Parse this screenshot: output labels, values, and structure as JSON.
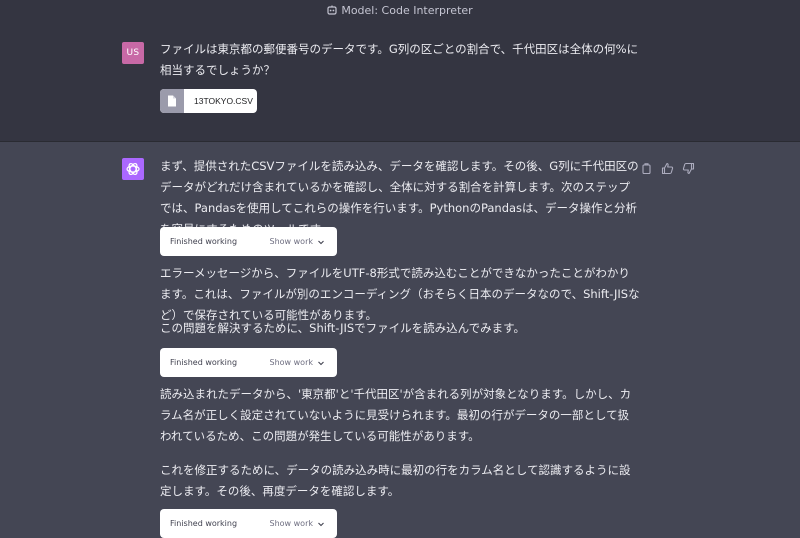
{
  "header": {
    "model_label": "Model: Code Interpreter"
  },
  "user_message": {
    "avatar_initials": "US",
    "text": "ファイルは東京都の郵便番号のデータです。G列の区ごとの割合で、千代田区は全体の何%に相当するでしょうか？",
    "attachment": {
      "file_name": "13TOKYO.CSV"
    }
  },
  "assistant": {
    "paragraphs": [
      "まず、提供されたCSVファイルを読み込み、データを確認します。その後、G列に千代田区のデータがどれだけ含まれているかを確認し、全体に対する割合を計算します。次のステップでは、Pandasを使用してこれらの操作を行います。PythonのPandasは、データ操作と分析を容易にするためのツールです。",
      "エラーメッセージから、ファイルをUTF-8形式で読み込むことができなかったことがわかります。これは、ファイルが別のエンコーディング（おそらく日本のデータなので、Shift-JISなど）で保存されている可能性があります。",
      "この問題を解決するために、Shift-JISでファイルを読み込んでみます。",
      "読み込まれたデータから、'東京都'と'千代田区'が含まれる列が対象となります。しかし、カラム名が正しく設定されていないように見受けられます。最初の行がデータの一部として扱われているため、この問題が発生している可能性があります。",
      "これを修正するために、データの読み込み時に最初の行をカラム名として認識するように設定します。その後、再度データを確認します。"
    ],
    "work_blocks": [
      {
        "status": "Finished working",
        "toggle": "Show work"
      },
      {
        "status": "Finished working",
        "toggle": "Show work"
      },
      {
        "status": "Finished working",
        "toggle": "Show work"
      }
    ]
  },
  "colors": {
    "user_bg": "#343541",
    "assistant_bg": "#444654",
    "user_avatar": "#c869a6",
    "gpt_avatar": "#ab68ff"
  }
}
